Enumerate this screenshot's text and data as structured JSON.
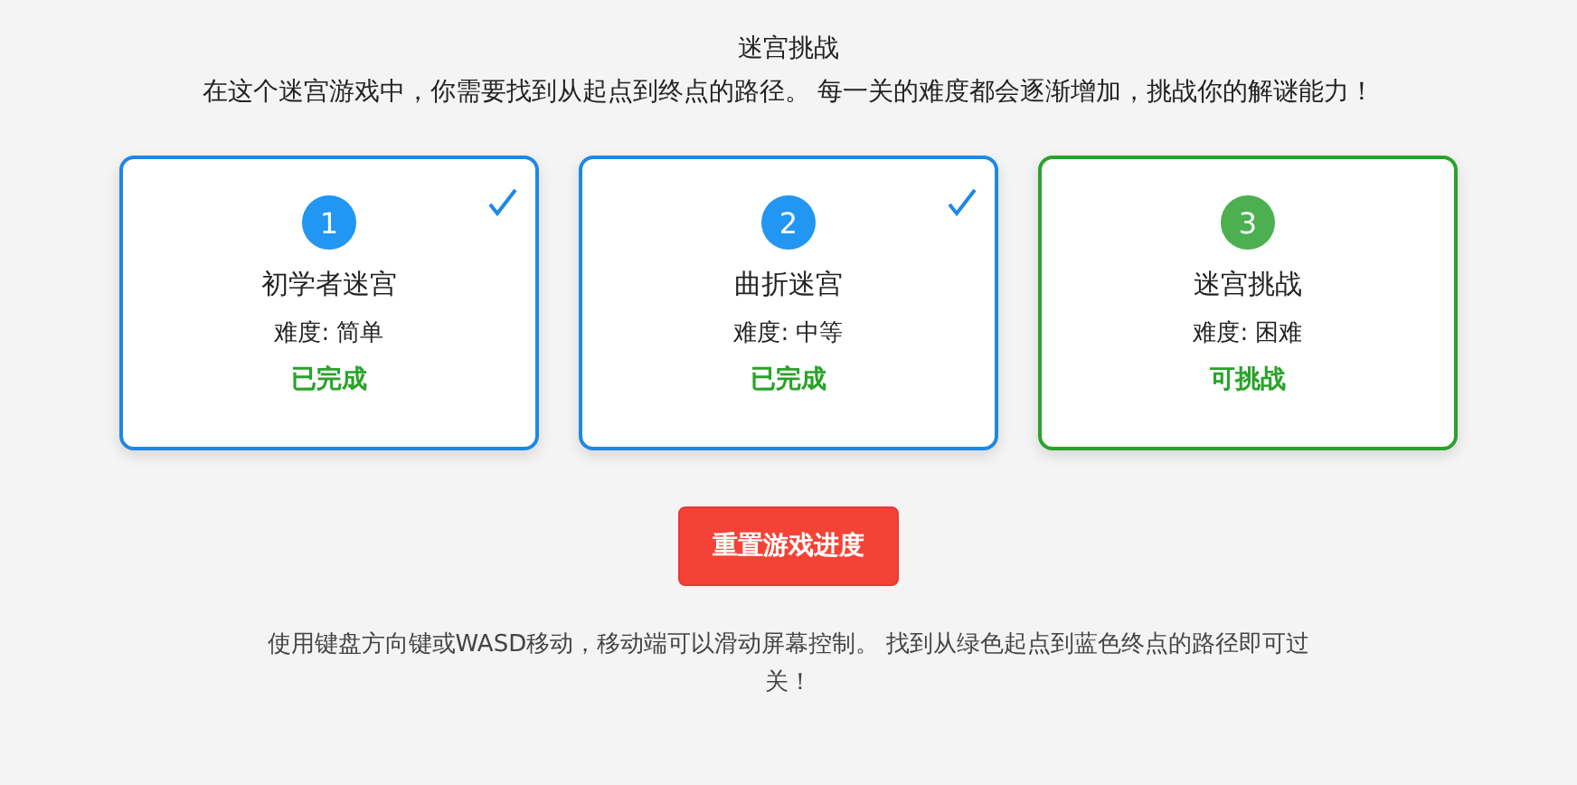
{
  "header": {
    "title": "迷宫挑战",
    "subtitle": "在这个迷宫游戏中，你需要找到从起点到终点的路径。 每一关的难度都会逐渐增加，挑战你的解谜能力！"
  },
  "levels": [
    {
      "number": "1",
      "name": "初学者迷宫",
      "difficulty": "难度: 简单",
      "status": "已完成",
      "completed": true
    },
    {
      "number": "2",
      "name": "曲折迷宫",
      "difficulty": "难度: 中等",
      "status": "已完成",
      "completed": true
    },
    {
      "number": "3",
      "name": "迷宫挑战",
      "difficulty": "难度: 困难",
      "status": "可挑战",
      "completed": false
    }
  ],
  "reset_button": "重置游戏进度",
  "instructions": "使用键盘方向键或WASD移动，移动端可以滑动屏幕控制。 找到从绿色起点到蓝色终点的路径即可过关！"
}
